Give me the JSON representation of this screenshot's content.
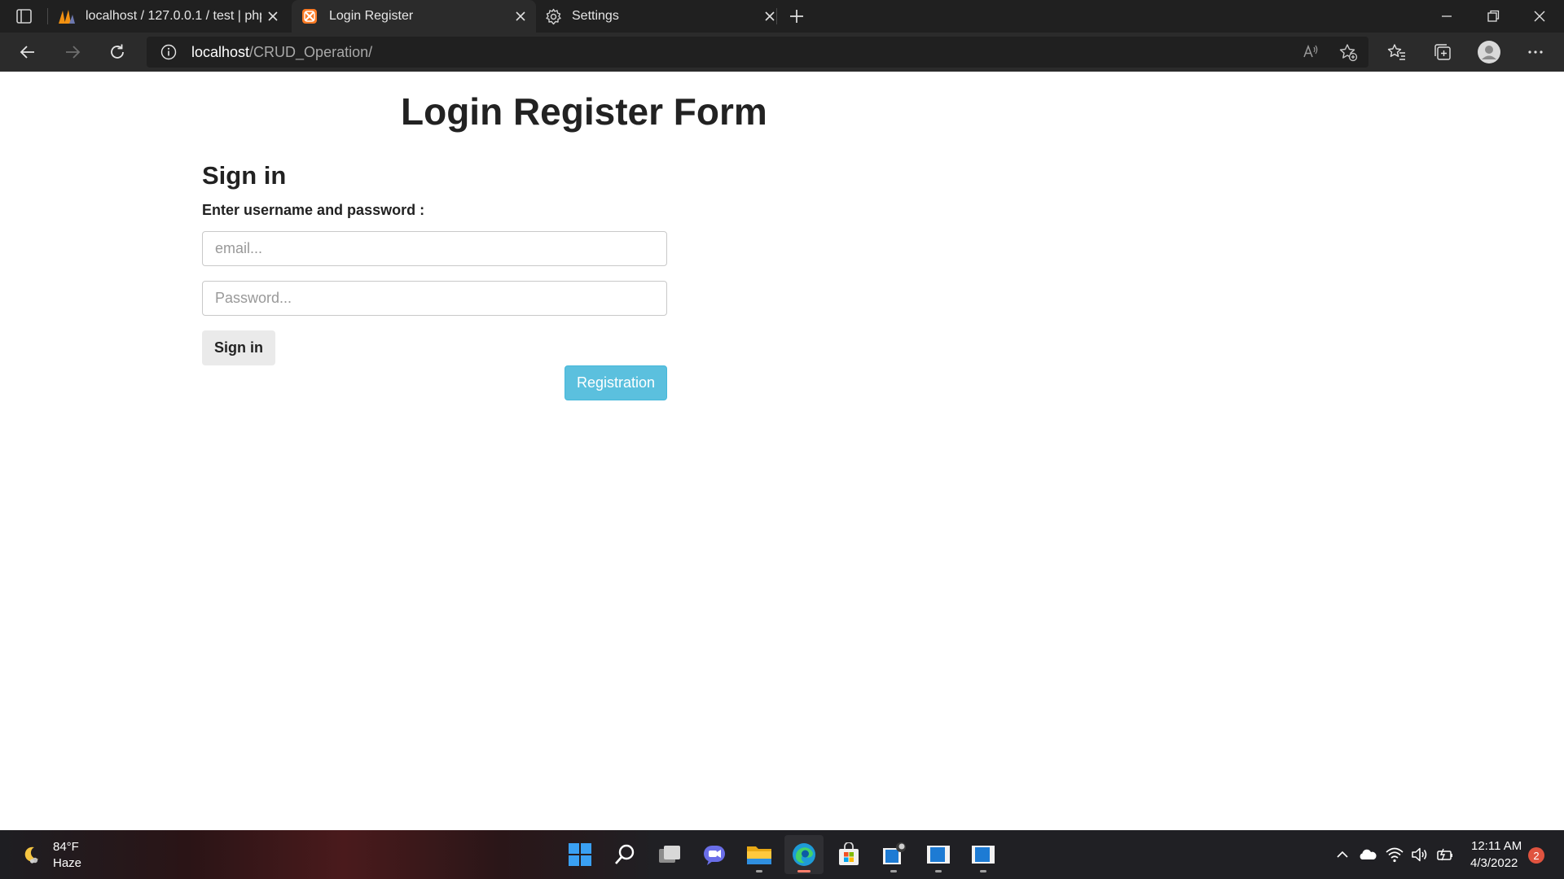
{
  "browser": {
    "tabs": [
      {
        "title": "localhost / 127.0.0.1 / test | phpMyAdmin",
        "icon": "phpmyadmin-icon",
        "active": false
      },
      {
        "title": "Login Register",
        "icon": "xampp-icon",
        "active": true
      },
      {
        "title": "Settings",
        "icon": "gear-icon",
        "active": false
      }
    ],
    "url_host": "localhost",
    "url_path": "/CRUD_Operation/"
  },
  "page": {
    "title": "Login Register Form",
    "signin_heading": "Sign in",
    "instructions": "Enter username and password :",
    "email_placeholder": "email...",
    "password_placeholder": "Password...",
    "signin_label": "Sign in",
    "registration_label": "Registration"
  },
  "taskbar": {
    "weather_temp": "84°F",
    "weather_condition": "Haze",
    "apps": [
      "windows-start-icon",
      "search-icon",
      "task-view-icon",
      "teams-chat-icon",
      "file-explorer-icon",
      "edge-icon",
      "store-icon",
      "app-icon",
      "app-icon",
      "app-icon"
    ],
    "time": "12:11 AM",
    "date": "4/3/2022",
    "notification_count": "2"
  },
  "colors": {
    "registration_button": "#5bc0de",
    "signin_button": "#eaeaea",
    "chrome_dark": "#202020",
    "chrome_mid": "#2b2b2b"
  }
}
